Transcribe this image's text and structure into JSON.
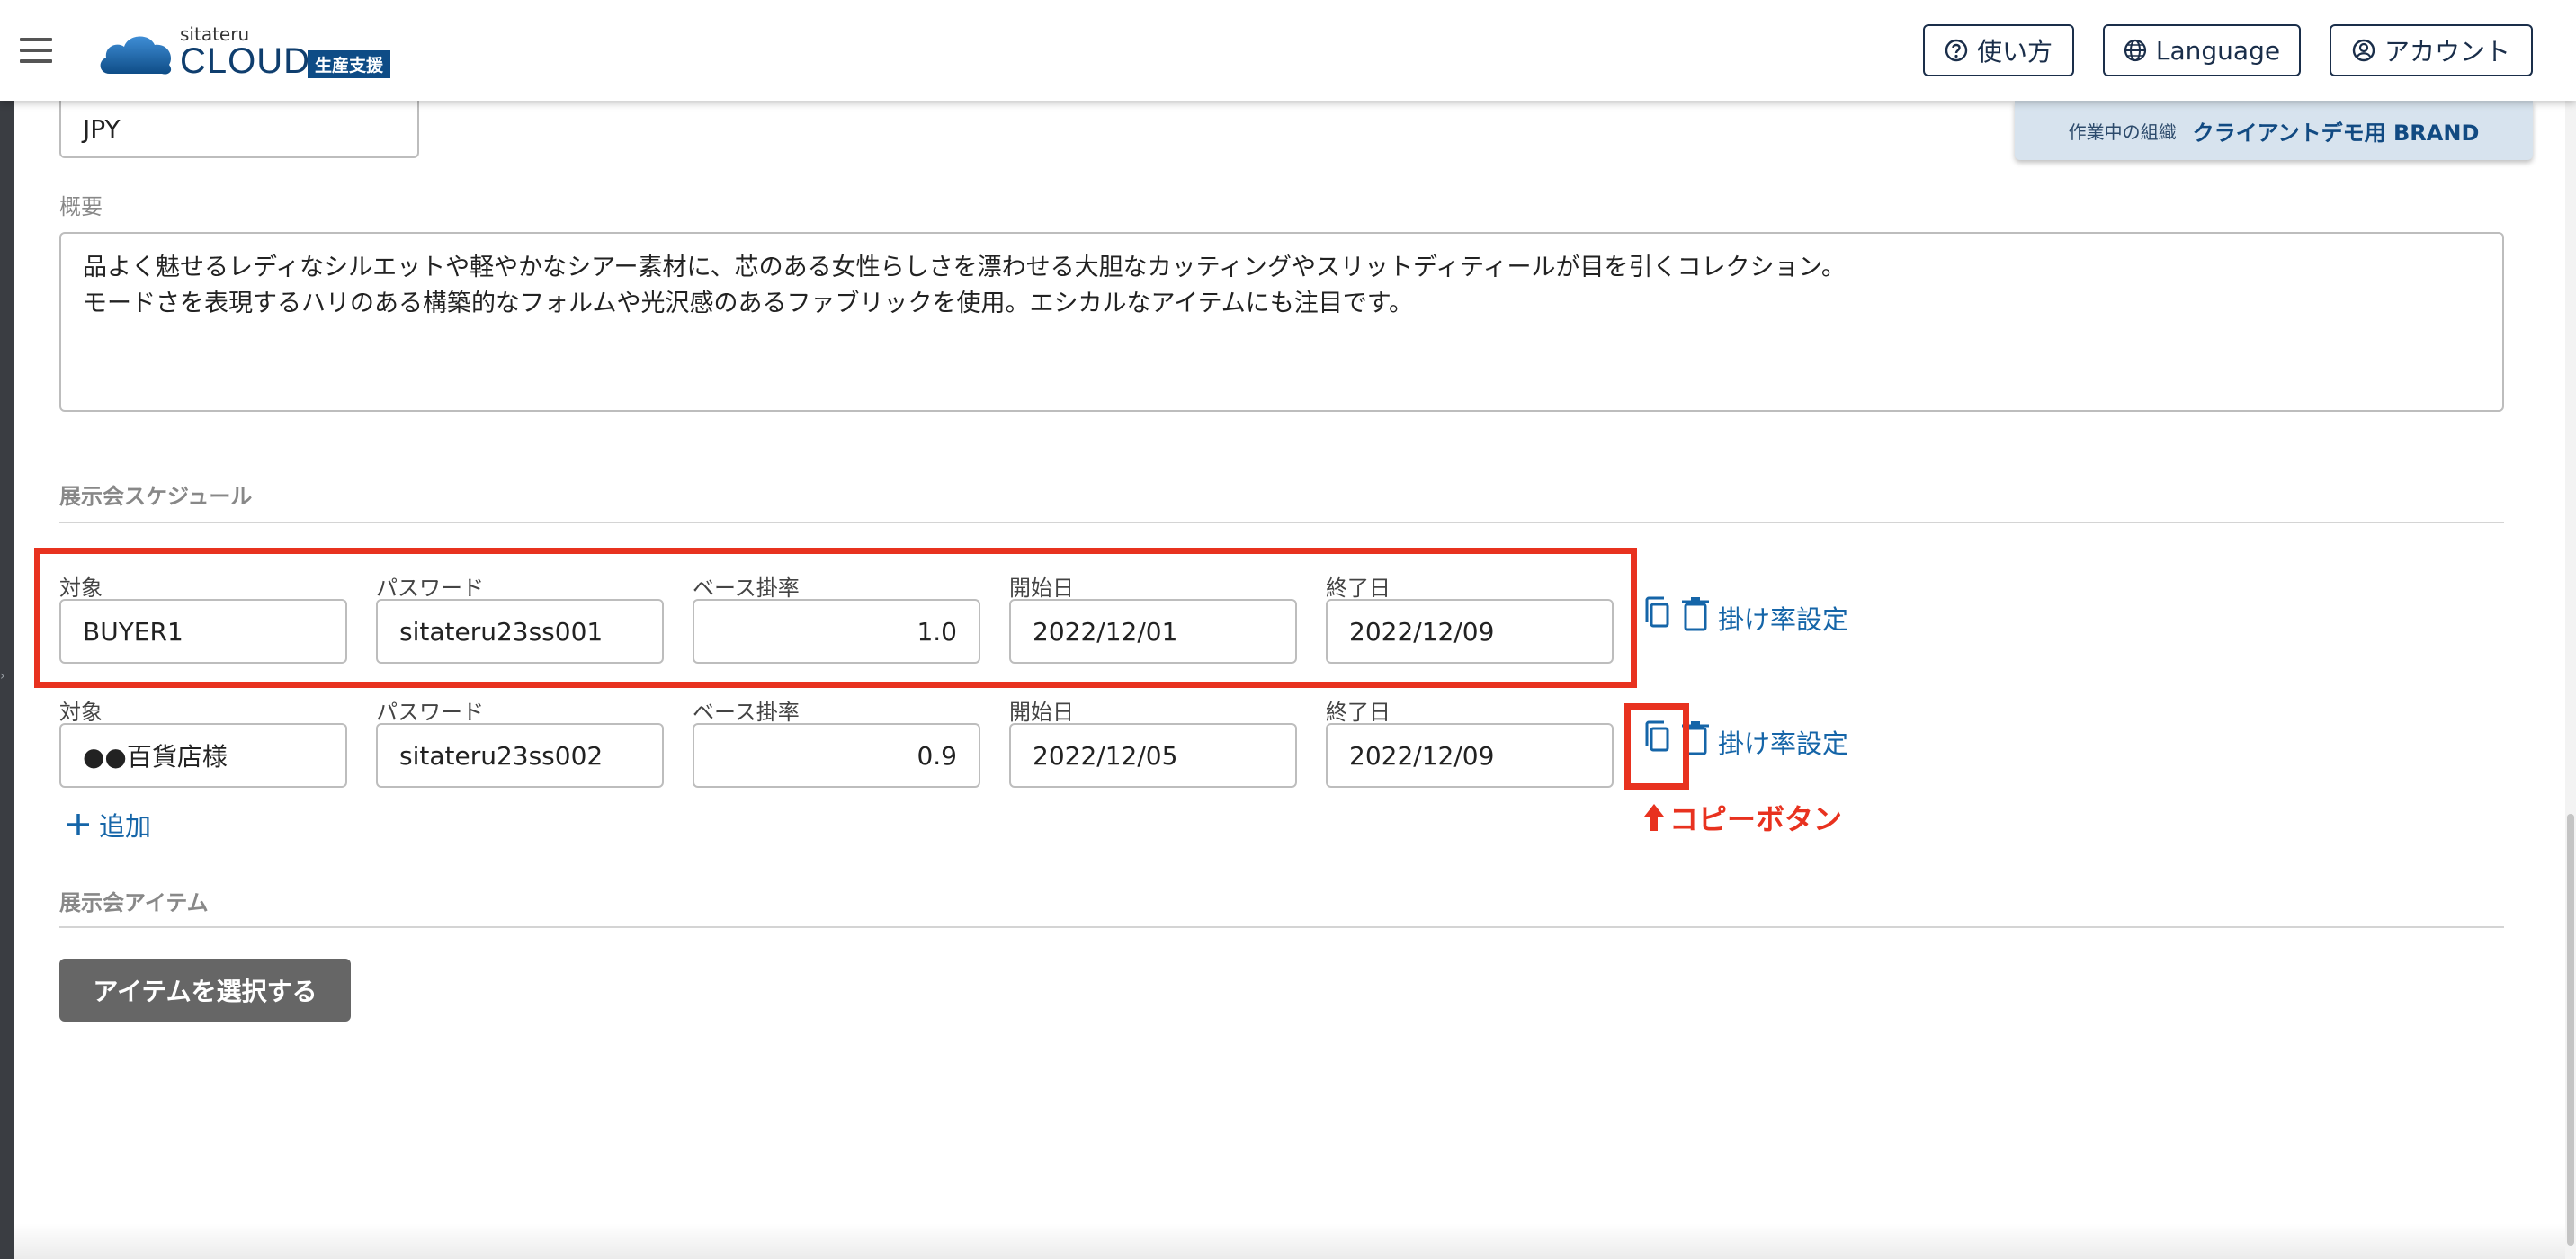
{
  "header": {
    "logo_small": "sitateru",
    "logo_big": "CLOUD",
    "logo_badge": "生産支援",
    "help_label": "使い方",
    "language_label": "Language",
    "account_label": "アカウント"
  },
  "org": {
    "label": "作業中の組織",
    "value": "クライアントデモ用 BRAND"
  },
  "currency": {
    "value": "JPY"
  },
  "summary": {
    "label": "概要",
    "line1": "品よく魅せるレディなシルエットや軽やかなシアー素材に、芯のある女性らしさを漂わせる大胆なカッティングやスリットディティールが目を引くコレクション。",
    "line2": "モードさを表現するハリのある構築的なフォルムや光沢感のあるファブリックを使用。エシカルなアイテムにも注目です。"
  },
  "schedule": {
    "title": "展示会スケジュール",
    "labels": {
      "target": "対象",
      "password": "パスワード",
      "base_rate": "ベース掛率",
      "start": "開始日",
      "end": "終了日"
    },
    "rows": [
      {
        "target": "BUYER1",
        "password": "sitateru23ss001",
        "base_rate": "1.0",
        "start": "2022/12/01",
        "end": "2022/12/09",
        "rate_link": "掛け率設定"
      },
      {
        "target": "●●百貨店様",
        "password": "sitateru23ss002",
        "base_rate": "0.9",
        "start": "2022/12/05",
        "end": "2022/12/09",
        "rate_link": "掛け率設定"
      }
    ],
    "add_label": "追加"
  },
  "annotation": {
    "text": "コピーボタン",
    "color": "#e8321f"
  },
  "items": {
    "title": "展示会アイテム",
    "select_button": "アイテムを選択する"
  },
  "colors": {
    "brand": "#0e4c86",
    "link": "#1565a8",
    "annotation": "#e8321f",
    "select_button": "#666666"
  }
}
